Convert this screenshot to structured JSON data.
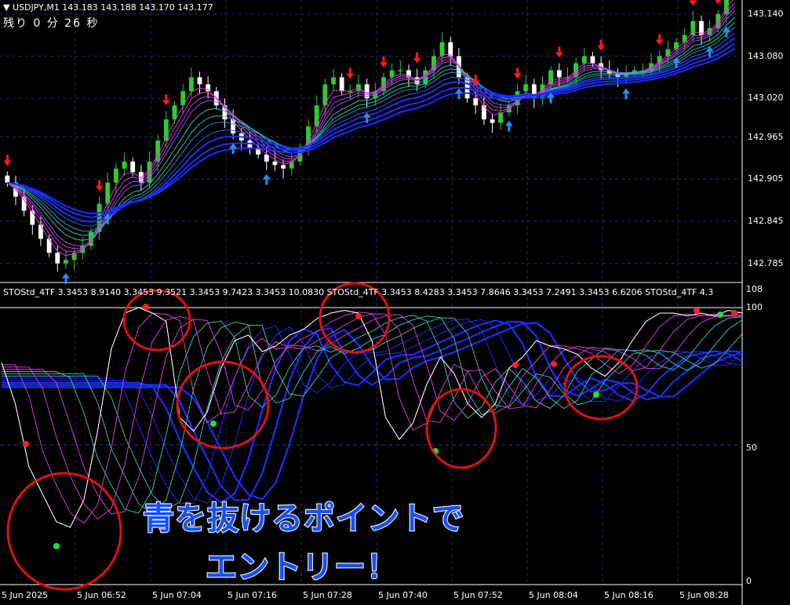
{
  "window": {
    "symbol_line": "USDJPY,M1  143.183 143.188 143.170 143.177",
    "remaining_time": "残り 0 分 26 秒"
  },
  "price_axis": {
    "ticks": [
      "143.140",
      "143.080",
      "143.020",
      "142.965",
      "142.905",
      "142.845",
      "142.785"
    ],
    "last_price": "143.177"
  },
  "indicator": {
    "header": "STOStd_4TF 3.3453 8.9140 3.3453 9.3521 3.3453 9.7423 3.3453 10.0830  STOStd_4TF 3.3453 8.4283 3.3453 7.8646 3.3453 7.2491 3.3453 6.6206  STOStd_4TF 4.3",
    "axis_ticks": [
      "108",
      "100",
      "50",
      "0"
    ],
    "level_lines": [
      100,
      50
    ]
  },
  "time_axis": {
    "labels": [
      "5 Jun 2025",
      "5 Jun 06:52",
      "5 Jun 07:04",
      "5 Jun 07:16",
      "5 Jun 07:28",
      "5 Jun 07:40",
      "5 Jun 07:52",
      "5 Jun 08:04",
      "5 Jun 08:16",
      "5 Jun 08:28"
    ]
  },
  "annotation": {
    "line1": "青を抜けるポイントで",
    "line2": "エントリー！",
    "circle_color": "#e01010",
    "text_color": "#1450ff"
  },
  "colors": {
    "background": "#000000",
    "grid": "#24286e",
    "bull_candle": "#2fcc2f",
    "bear_candle": "#ffffff",
    "sell_arrow": "#ff1a1a",
    "buy_arrow": "#2a8cff",
    "ma_slow": "#1a2fff",
    "ma_mid": "#30c0b0",
    "ma_fast": "#d23cd2"
  },
  "chart_data": {
    "type": "candlestick",
    "ylim": [
      142.76,
      143.16
    ],
    "closes": [
      142.9,
      142.88,
      142.86,
      142.84,
      142.82,
      142.8,
      142.785,
      142.79,
      142.8,
      142.81,
      142.83,
      142.87,
      142.9,
      142.92,
      142.93,
      142.915,
      142.9,
      142.93,
      142.96,
      142.99,
      143.01,
      143.03,
      143.05,
      143.04,
      143.03,
      143.01,
      142.99,
      142.97,
      142.96,
      142.95,
      142.94,
      142.93,
      142.925,
      142.92,
      142.93,
      142.95,
      142.98,
      143.01,
      143.04,
      143.05,
      143.03,
      143.03,
      143.04,
      143.02,
      143.03,
      143.05,
      143.06,
      143.06,
      143.05,
      143.04,
      143.06,
      143.08,
      143.1,
      143.08,
      143.05,
      143.02,
      143.01,
      142.99,
      142.985,
      143.0,
      143.01,
      143.03,
      143.04,
      143.02,
      143.04,
      143.06,
      143.05,
      143.05,
      143.07,
      143.08,
      143.07,
      143.06,
      143.055,
      143.05,
      143.055,
      143.06,
      143.06,
      143.07,
      143.08,
      143.09,
      143.1,
      143.11,
      143.13,
      143.11,
      143.12,
      143.14,
      143.17,
      143.177
    ],
    "stoch_fast": [
      80,
      65,
      42,
      32,
      22,
      20,
      30,
      55,
      85,
      98,
      100,
      98,
      95,
      60,
      55,
      62,
      78,
      88,
      90,
      84,
      86,
      90,
      92,
      96,
      98,
      99,
      98,
      88,
      60,
      52,
      58,
      72,
      82,
      76,
      65,
      60,
      65,
      78,
      82,
      88,
      86,
      85,
      83,
      78,
      75,
      80,
      88,
      95,
      98,
      98,
      97,
      98,
      97,
      99,
      98
    ],
    "stoch_slow": [
      70,
      66,
      58,
      48,
      38,
      32,
      30,
      36,
      50,
      68,
      82,
      90,
      92,
      88,
      80,
      74,
      74,
      78,
      80,
      82,
      84,
      86,
      88,
      90,
      92,
      94,
      94,
      90,
      82,
      74,
      70,
      70,
      72,
      72,
      70,
      68,
      68,
      72,
      76,
      80,
      82,
      84,
      84,
      82,
      80,
      80,
      84,
      88,
      92,
      94,
      95,
      96,
      96,
      97,
      97
    ]
  }
}
